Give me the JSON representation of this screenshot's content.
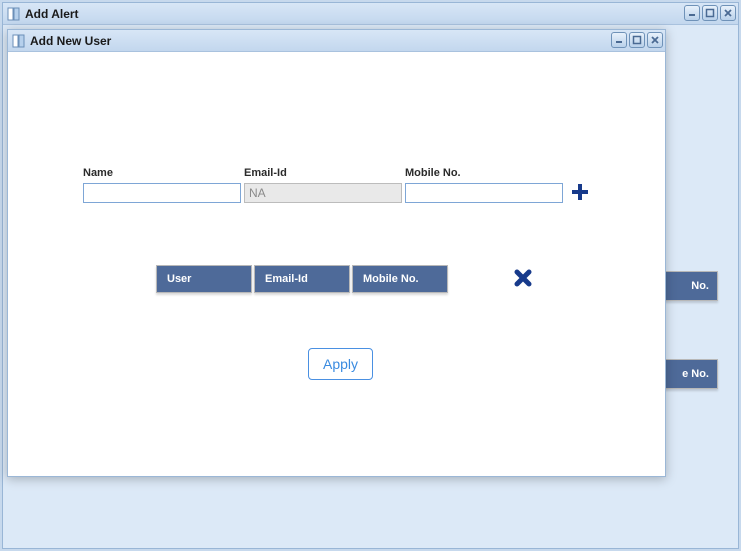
{
  "outer_window": {
    "title": "Add Alert"
  },
  "inner_window": {
    "title": "Add New User"
  },
  "form": {
    "name_label": "Name",
    "name_value": "",
    "email_label": "Email-Id",
    "email_value": "NA",
    "mobile_label": "Mobile No.",
    "mobile_value": ""
  },
  "table": {
    "headers": {
      "user": "User",
      "email": "Email-Id",
      "mobile": "Mobile No."
    }
  },
  "apply_label": "Apply",
  "bg": {
    "right1": "No.",
    "right2": "e No."
  }
}
